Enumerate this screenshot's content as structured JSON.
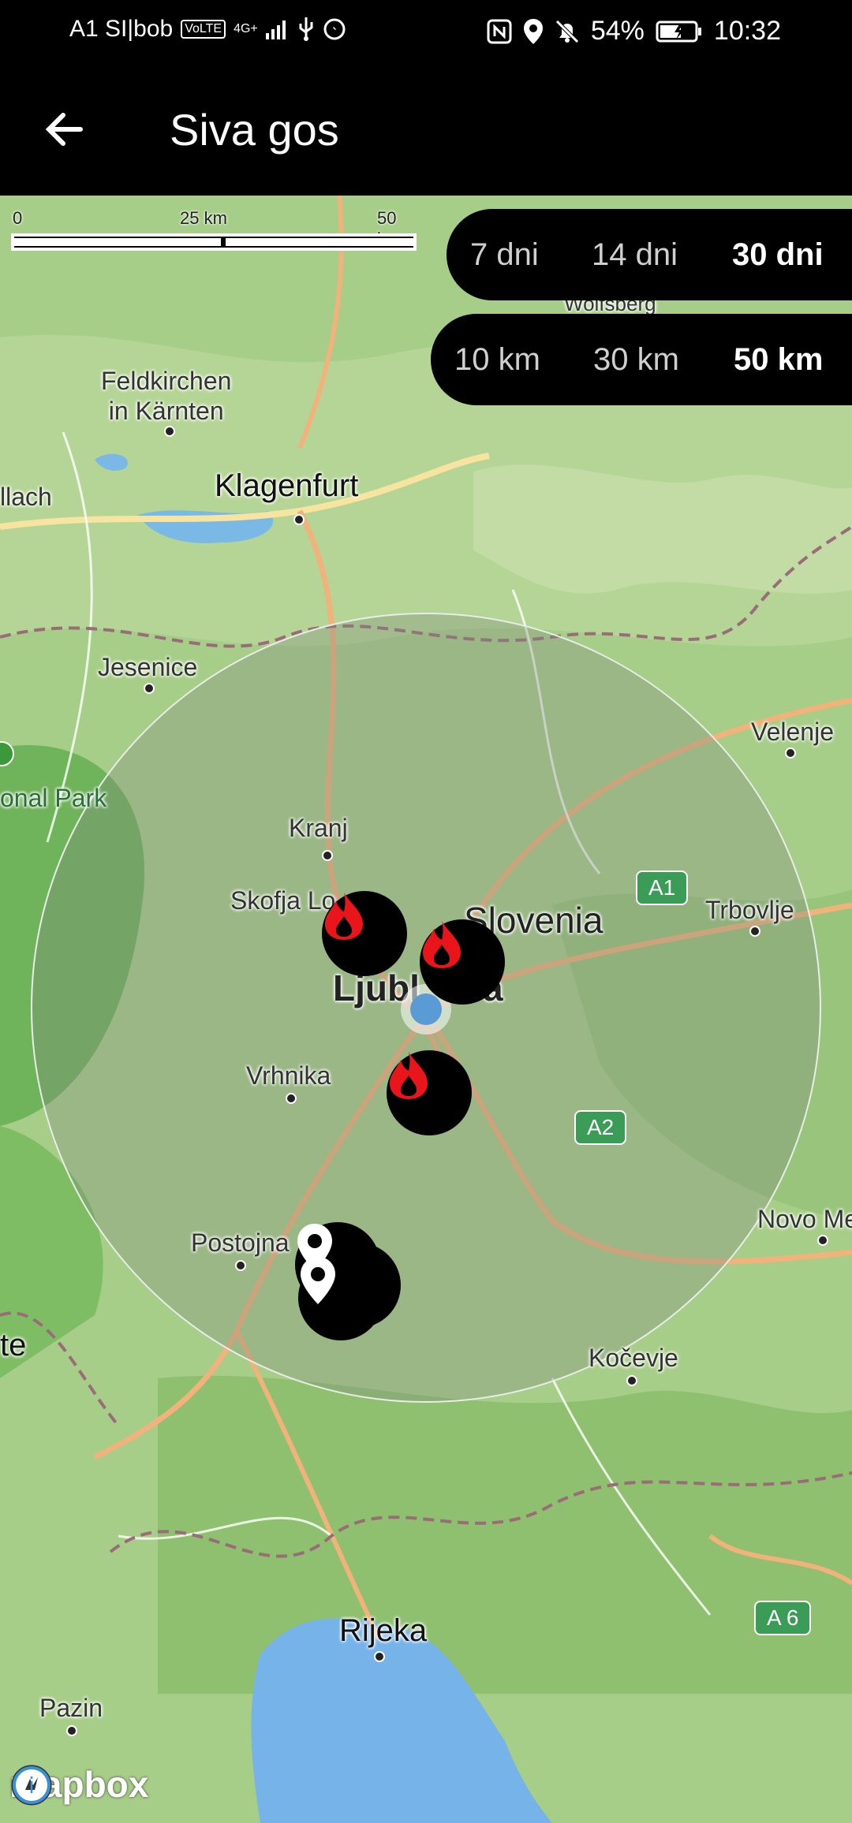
{
  "status_bar": {
    "carrier": "A1 SI|bob",
    "volte": "VoLTE",
    "network": "4G+",
    "battery": "54%",
    "time": "10:32",
    "icons": [
      "volte-icon",
      "signal-icon",
      "usb-icon",
      "messenger-icon",
      "nfc-icon",
      "location-icon",
      "bell-off-icon",
      "battery-icon"
    ]
  },
  "app_bar": {
    "back_icon": "arrow-left-icon",
    "title": "Siva gos"
  },
  "scale_bar": {
    "start": "0",
    "mid": "25 km",
    "end": "50 km"
  },
  "filters": {
    "days": {
      "options": [
        "7 dni",
        "14 dni",
        "30 dni"
      ],
      "selected": "30 dni"
    },
    "radius": {
      "options": [
        "10 km",
        "30 km",
        "50 km"
      ],
      "selected": "50 km"
    }
  },
  "map": {
    "provider": "mapbox",
    "places": {
      "feldkirchen": "Feldkirchen\nin Kärnten",
      "klagenfurt": "Klagenfurt",
      "villach": "llach",
      "jesenice": "Jesenice",
      "national_park": "onal Park",
      "velenje": "Velenje",
      "kranj": "Kranj",
      "skofja_loka": "Skofja Lo",
      "slovenia": "Slovenia",
      "ljubljana": "Ljubl",
      "ljubljana_end": "a",
      "trbovlje": "Trbovlje",
      "vrhnika": "Vrhnika",
      "postojna": "Postojna",
      "novo_mesto": "Novo Me",
      "trieste": "te",
      "kocevje": "Kočevje",
      "rijeka": "Rijeka",
      "pazin": "Pazin",
      "wolfsberg": "Wolfsberg"
    },
    "highway_badges": [
      "A1",
      "A2",
      "A 6"
    ],
    "radius_km": 50,
    "markers": {
      "fire_count": 3,
      "pin_count": 2,
      "fire_icon": "flame-icon",
      "pin_icon": "location-pin-icon",
      "user_icon": "current-location-icon"
    },
    "colors": {
      "fire": "#e8151b",
      "user": "#5b9bd5",
      "marker_bg": "#000000"
    }
  }
}
